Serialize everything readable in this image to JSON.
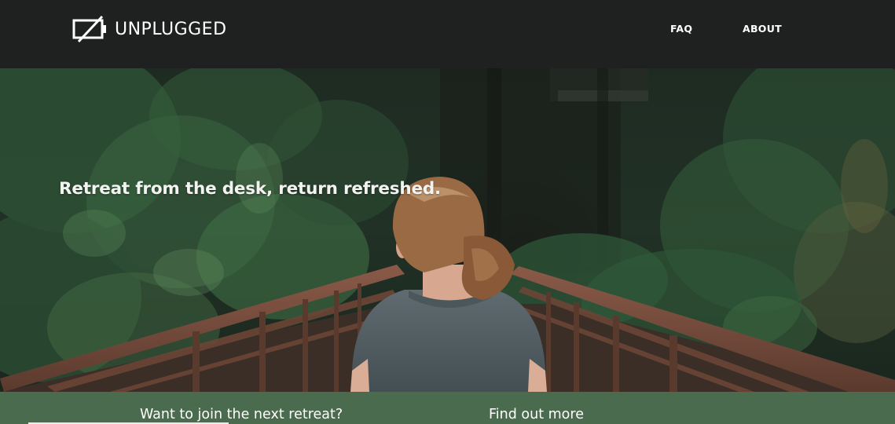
{
  "brand": {
    "logo_text": "UNPLUGGED",
    "logo_icon": "unplugged-battery-icon"
  },
  "nav": {
    "items": [
      {
        "label": "FAQ"
      },
      {
        "label": "ABOUT"
      }
    ]
  },
  "hero": {
    "heading": "Retreat from the desk, return refreshed.",
    "image": "woman-on-forest-bridge-photo"
  },
  "cta": {
    "join_text": "Want to join the next retreat?",
    "more_text": "Find out more"
  },
  "colors": {
    "navbar_bg": "#1f2020",
    "band_bg": "#4b6b4e",
    "text": "#ffffff"
  }
}
